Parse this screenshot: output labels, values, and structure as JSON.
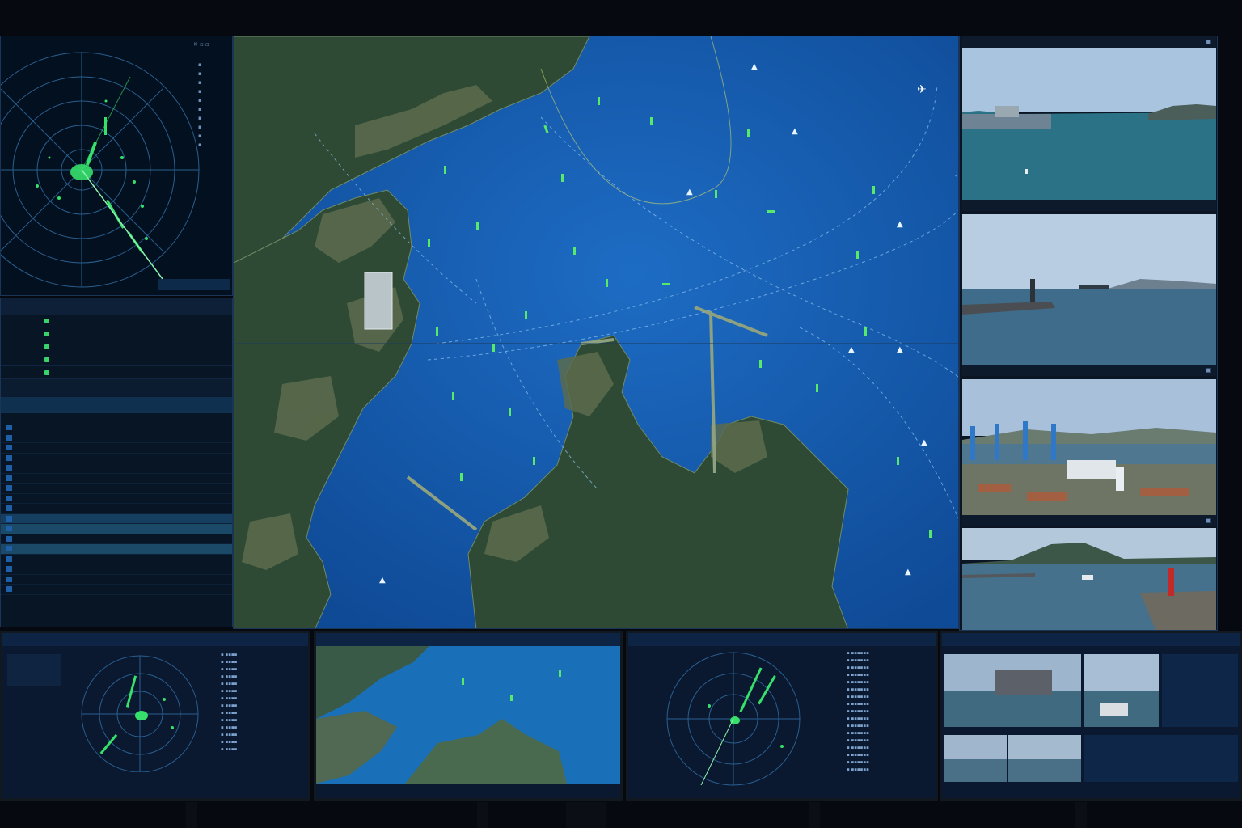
{
  "scene": "Maritime vessel traffic control room video wall",
  "colors": {
    "sea": "#1455a8",
    "land": "#2d4a33",
    "land_urban": "#5a6a4c",
    "radar_green": "#36e06a",
    "panel_bg": "#0a1626",
    "track_line": "#5cc0ff"
  },
  "icons": {
    "vessel": "vessel-icon",
    "aircraft": "aircraft-icon",
    "camera": "camera-icon",
    "settings": "gear-icon",
    "close": "close-icon"
  },
  "radar_main": {
    "sweep_color": "#36e06a"
  },
  "main_map": {
    "view": "harbor-chart"
  },
  "camera_feeds": [
    {
      "name": "harbor-overview-feed"
    },
    {
      "name": "lighthouse-breakwater-feed"
    },
    {
      "name": "container-terminal-feed"
    },
    {
      "name": "red-lighthouse-feed"
    }
  ],
  "bottom_monitors": {
    "mon4_feeds": [
      "cargo-ship-feed",
      "pilot-boat-feed",
      "open-water-feed-1",
      "open-water-feed-2"
    ]
  }
}
